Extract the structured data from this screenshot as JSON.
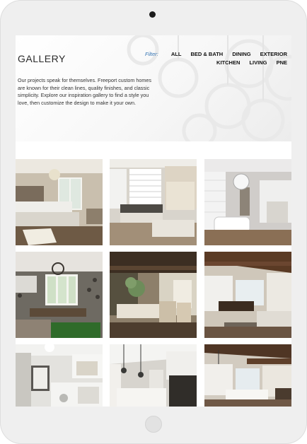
{
  "page": {
    "title": "GALLERY"
  },
  "filter": {
    "label": "Filter:",
    "items": [
      "ALL",
      "BED & BATH",
      "DINING",
      "EXTERIOR",
      "KITCHEN",
      "LIVING",
      "PNE"
    ]
  },
  "intro": "Our projects speak for themselves. Freeport custom homes are known for their clean lines, quality finishes, and classic simplicity. Explore our inspiration gallery to find a style you love, then customize the design to make it your own.",
  "gallery": {
    "photos": [
      {
        "subject": "bedroom"
      },
      {
        "subject": "window-seat-room"
      },
      {
        "subject": "bathroom"
      },
      {
        "subject": "dining-room-patterned-wallpaper"
      },
      {
        "subject": "dining-room-dark-beams"
      },
      {
        "subject": "kitchen-living-dark-beams"
      },
      {
        "subject": "kitchen-laundry"
      },
      {
        "subject": "kitchen-pendants"
      },
      {
        "subject": "kitchen-open-plan"
      }
    ]
  },
  "colors": {
    "filter_label": "#3a78b5",
    "text": "#333333"
  }
}
